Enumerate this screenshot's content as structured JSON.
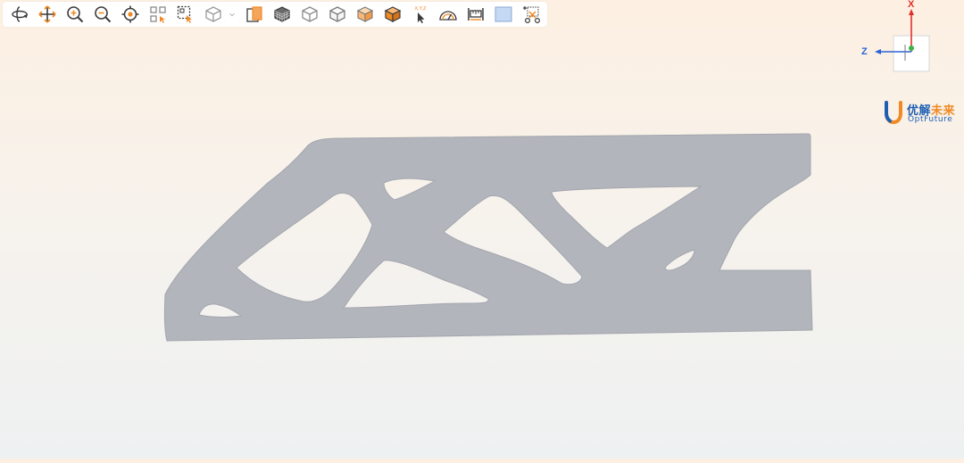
{
  "toolbar": {
    "tools": [
      {
        "name": "rotate-view-icon"
      },
      {
        "name": "pan-icon"
      },
      {
        "name": "zoom-in-icon"
      },
      {
        "name": "zoom-out-icon"
      },
      {
        "name": "fit-center-icon"
      },
      {
        "name": "select-region-icon"
      },
      {
        "name": "box-select-icon"
      },
      {
        "name": "view-cube-icon"
      },
      {
        "name": "section-plane-icon"
      },
      {
        "name": "mesh-display-icon"
      },
      {
        "name": "wireframe-cube-icon"
      },
      {
        "name": "hidden-line-cube-icon"
      },
      {
        "name": "shaded-edges-cube-icon"
      },
      {
        "name": "shaded-cube-icon"
      },
      {
        "name": "pick-point-icon"
      },
      {
        "name": "measure-angle-icon"
      },
      {
        "name": "measure-distance-icon"
      },
      {
        "name": "background-color-icon"
      },
      {
        "name": "clear-selection-icon"
      }
    ],
    "pick_point_label": "X,Y,Z"
  },
  "axis": {
    "x_label": "X",
    "z_label": "Z",
    "x_color": "#e0302a",
    "z_color": "#2a64d6"
  },
  "logo": {
    "cn_part1": "优解",
    "cn_part2": "未来",
    "en": "OptFuture",
    "blue": "#1e5fb4",
    "orange": "#f08a24"
  },
  "model": {
    "color": "#b2b5bc"
  }
}
